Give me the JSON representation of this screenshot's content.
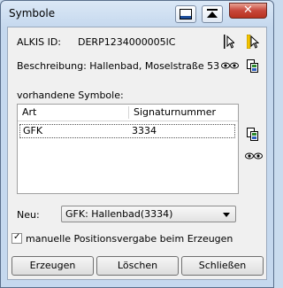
{
  "window": {
    "title": "Symbole",
    "close_glyph": "✕"
  },
  "alkis": {
    "label": "ALKIS ID:",
    "value": "DERP1234000005lC"
  },
  "beschreibung": {
    "text": "Beschreibung: Hallenbad, Moselstraße 53"
  },
  "symbols_section": {
    "label": "vorhandene Symbole:"
  },
  "table": {
    "columns": [
      "Art",
      "Signaturnummer"
    ],
    "rows": [
      {
        "art": "GFK",
        "signaturnummer": "3334"
      }
    ]
  },
  "neu": {
    "label": "Neu:",
    "selected": "GFK: Hallenbad(3334)"
  },
  "checkbox": {
    "label": "manuelle Positionsvergabe beim Erzeugen",
    "checked": true,
    "mark": "✓"
  },
  "buttons": {
    "erzeugen": "Erzeugen",
    "loeschen": "Löschen",
    "schliessen": "Schließen"
  },
  "icons": {
    "titlebar": [
      "minimize-to-bar-icon",
      "collapse-up-icon"
    ],
    "alkis_row": [
      "pointer-cursor-icon",
      "pointer-highlight-icon"
    ],
    "beschreibung_row": [
      "view-eyes-icon",
      "copy-symbol-icon"
    ],
    "list_side": [
      "copy-symbol-icon",
      "view-eyes-icon"
    ]
  }
}
